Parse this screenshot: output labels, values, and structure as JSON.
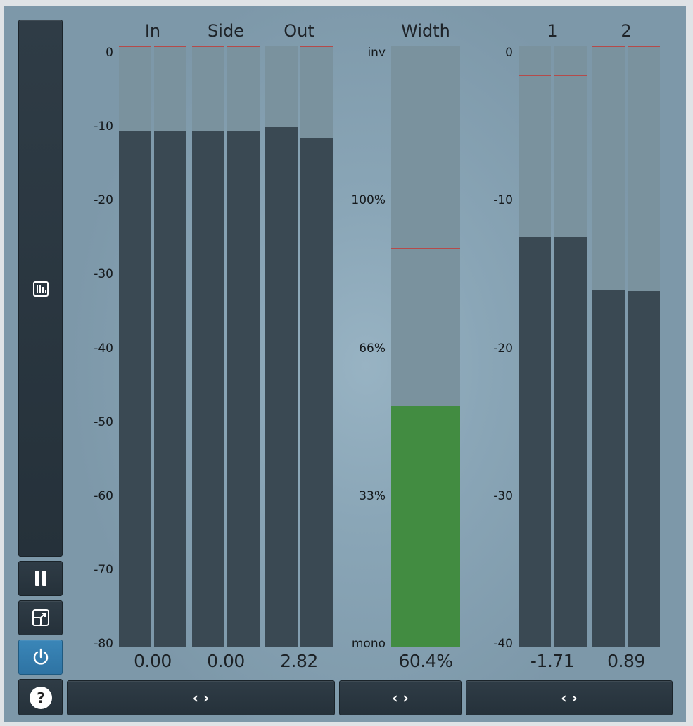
{
  "columns": {
    "in": "In",
    "side": "Side",
    "out": "Out",
    "width": "Width",
    "band1": "1",
    "band2": "2"
  },
  "level_scale": [
    "0",
    "-10",
    "-20",
    "-30",
    "-40",
    "-50",
    "-60",
    "-70",
    "-80"
  ],
  "width_scale": [
    "inv",
    "100%",
    "66%",
    "33%",
    "mono"
  ],
  "band_scale": [
    "0",
    "-10",
    "-20",
    "-30",
    "-40"
  ],
  "readouts": {
    "in": "0.00",
    "side": "0.00",
    "out": "2.82",
    "width": "60.4%",
    "band1": "-1.71",
    "band2": "0.89"
  },
  "meters": {
    "level_range_db": [
      -80,
      0
    ],
    "in_left_db": -11.2,
    "in_right_db": -11.3,
    "side_left_db": -11.2,
    "side_right_db": -11.3,
    "out_left_db": -10.7,
    "out_right_db": -12.2,
    "in_peak_db": 0,
    "side_peak_db": 0,
    "out_peak_db": 0,
    "width_percent": 60.4,
    "width_peak_label": "100%",
    "band_range_db": [
      -40,
      0
    ],
    "band1_left_db": -12.7,
    "band1_right_db": -12.7,
    "band2_left_db": -16.2,
    "band2_right_db": -16.3,
    "band1_peak_db": -1.9,
    "band2_peak_db": 0
  },
  "icons": {
    "meter_mode": "bar-graph-icon",
    "pause": "pause-icon",
    "resize": "resize-icon",
    "power": "power-icon",
    "help": "help-icon",
    "expand": "left-right-arrows-icon"
  },
  "symbols": {
    "help": "?",
    "expand": "‹ ›"
  },
  "colors": {
    "meter_fill": "#3a4953",
    "meter_track": "#7a929e",
    "width_fill": "#428c41",
    "peak_line": "#b54a4a",
    "power_active": "#3a86b8"
  }
}
